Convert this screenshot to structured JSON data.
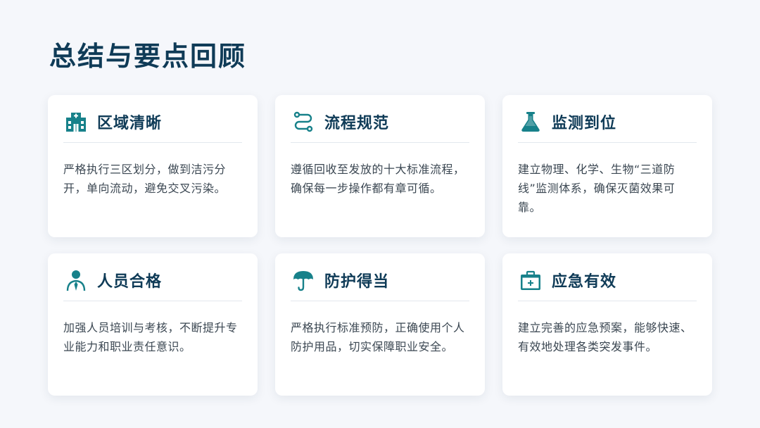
{
  "page": {
    "title": "总结与要点回顾"
  },
  "colors": {
    "accent": "#17818a",
    "title": "#0f3b57",
    "text": "#3b4752",
    "background": "#f5f7fb"
  },
  "cards": [
    {
      "icon": "hospital-building-icon",
      "title": "区域清晰",
      "desc": "严格执行三区划分，做到洁污分开，单向流动，避免交叉污染。"
    },
    {
      "icon": "process-flow-icon",
      "title": "流程规范",
      "desc": "遵循回收至发放的十大标准流程，确保每一步操作都有章可循。"
    },
    {
      "icon": "flask-icon",
      "title": "监测到位",
      "desc": "建立物理、化学、生物“三道防线”监测体系，确保灭菌效果可靠。"
    },
    {
      "icon": "person-icon",
      "title": "人员合格",
      "desc": "加强人员培训与考核，不断提升专业能力和职业责任意识。"
    },
    {
      "icon": "umbrella-icon",
      "title": "防护得当",
      "desc": "严格执行标准预防，正确使用个人防护用品，切实保障职业安全。"
    },
    {
      "icon": "first-aid-kit-icon",
      "title": "应急有效",
      "desc": "建立完善的应急预案，能够快速、有效地处理各类突发事件。"
    }
  ]
}
